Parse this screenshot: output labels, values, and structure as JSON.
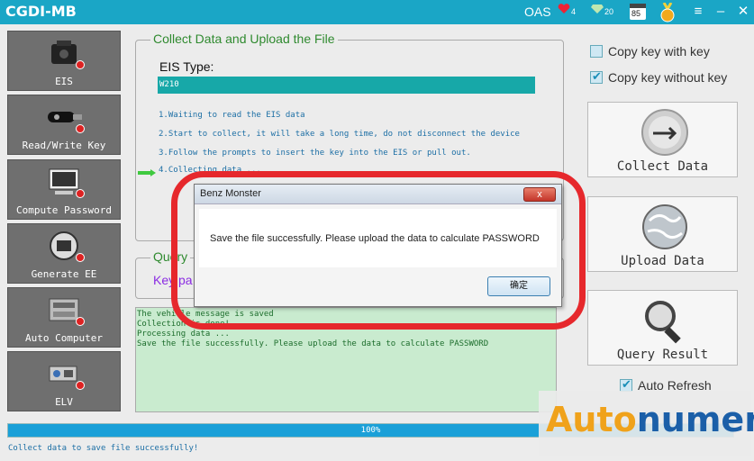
{
  "window": {
    "title": "CGDI-MB",
    "oas_label": "OAS",
    "hearts": "4",
    "gems": "20",
    "calendar_day": "85"
  },
  "sidebar": {
    "items": [
      {
        "label": "EIS"
      },
      {
        "label": "Read/Write Key"
      },
      {
        "label": "Compute Password"
      },
      {
        "label": "Generate EE"
      },
      {
        "label": "Auto Computer"
      },
      {
        "label": "ELV"
      }
    ]
  },
  "collect": {
    "title": "Collect Data and Upload the File",
    "eis_type_label": "EIS Type:",
    "eis_type_value": "W210",
    "steps": [
      "1.Waiting to read the EIS data",
      "2.Start to collect, it will take a long time, do not disconnect the device",
      "3.Follow the prompts to insert the key into the EIS or pull out.",
      "4.Collecting data ..."
    ]
  },
  "query": {
    "title": "Query",
    "key_label": "Key pa"
  },
  "log": {
    "lines": [
      "The vehicle message is saved",
      "Collection is done!",
      "Processing data ...",
      "Save the file successfully. Please upload the data to calculate PASSWORD"
    ]
  },
  "options": {
    "copy_with_key": "Copy key with key",
    "copy_without_key": "Copy key without key",
    "copy_with_key_checked": false,
    "copy_without_key_checked": true
  },
  "actions": {
    "collect": "Collect Data",
    "upload": "Upload  Data",
    "query": "Query Result"
  },
  "auto_refresh": {
    "label": "Auto Refresh",
    "checked": true
  },
  "progress": {
    "value": 1.0,
    "text": "100%"
  },
  "status_text": "Collect data to save file successfully!",
  "dialog": {
    "title": "Benz Monster",
    "message": "Save the file successfully. Please upload the data to calculate PASSWORD",
    "ok_label": "确定",
    "close_label": "x"
  },
  "watermark": {
    "part1": "Auto",
    "part2": "numen"
  },
  "colors": {
    "titlebar": "#1aa6c6",
    "accent_green": "#2f8a2f",
    "log_bg": "#c9ebcf",
    "highlight": "#e6282c"
  }
}
